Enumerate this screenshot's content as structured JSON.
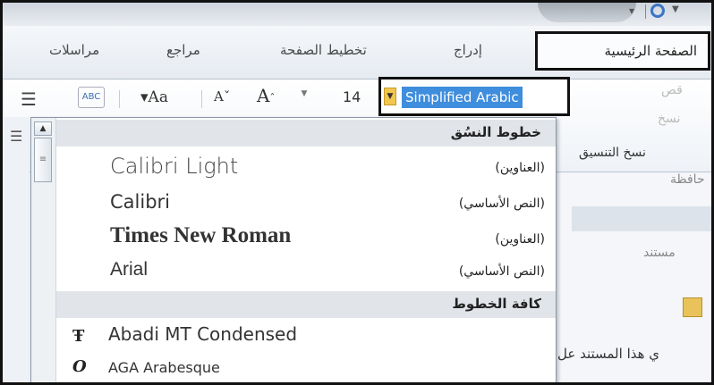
{
  "tabs": [
    {
      "label": "الصفحة الرئيسية",
      "active": true
    },
    {
      "label": "إدراج"
    },
    {
      "label": "تخطيط الصفحة"
    },
    {
      "label": "مراجع"
    },
    {
      "label": "مراسلات"
    }
  ],
  "ribbon": {
    "font_name": "Simplified Arabic",
    "font_size": "14",
    "change_case_label": "Aa",
    "shrink_label": "A",
    "grow_label": "A",
    "spell_label": "ABC",
    "cut_label": "قص",
    "copy_label": "نسخ",
    "format_painter_label": "نسخ التنسيق",
    "clipboard_label": "حافظة"
  },
  "dropdown": {
    "theme_fonts_header": "خطوط النسُق",
    "theme_fonts": [
      {
        "name": "Calibri Light",
        "role": "(العناوين)"
      },
      {
        "name": "Calibri",
        "role": "(النص الأساسي)"
      },
      {
        "name": "Times New Roman",
        "role": "(العناوين)"
      },
      {
        "name": "Arial",
        "role": "(النص الأساسي)"
      }
    ],
    "all_fonts_header": "كافة الخطوط",
    "all_fonts": [
      {
        "name": "Abadi MT Condensed",
        "glyph": "Ŧ"
      },
      {
        "name": "AGA Arabesque",
        "glyph": "O"
      }
    ]
  },
  "document": {
    "band_text": "مستند",
    "body_text": "ي هذا المستند عل"
  }
}
